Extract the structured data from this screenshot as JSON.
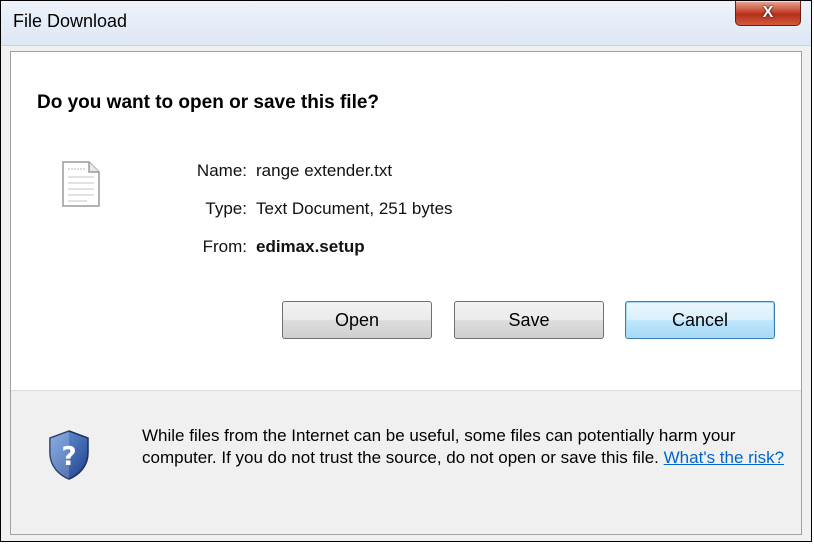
{
  "window": {
    "title": "File Download",
    "close_glyph": "X"
  },
  "dialog": {
    "question": "Do you want to open or save this file?",
    "file_icon": "text-file-icon",
    "fields": [
      {
        "label": "Name:",
        "value": "range extender.txt"
      },
      {
        "label": "Type:",
        "value": "Text Document, 251 bytes"
      },
      {
        "label": "From:",
        "value": "edimax.setup"
      }
    ]
  },
  "buttons": {
    "open_label": "Open",
    "save_label": "Save",
    "cancel_label": "Cancel"
  },
  "footer": {
    "icon": "security-shield-question-icon",
    "warning_text": "While files from the Internet can be useful, some files can potentially harm your computer. If you do not trust the source, do not open or save this file.",
    "risk_link": "What's the risk?"
  },
  "colors": {
    "link": "#0066cc",
    "shield": "#2b5aa8",
    "close": "#c8472d"
  }
}
